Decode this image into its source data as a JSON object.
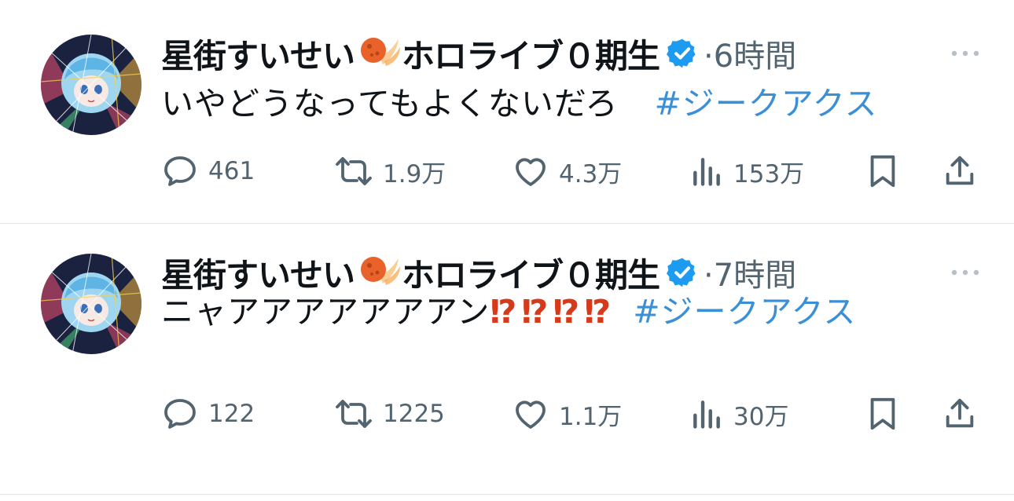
{
  "tweets": [
    {
      "author_name_part1": "星街すいせい",
      "author_name_part2": "ホロライブ０期生",
      "time": "·6時間",
      "text": "いやどうなってもよくないだろ",
      "hashtag": "#ジークアクス",
      "reply_count": "461",
      "retweet_count": "1.9万",
      "like_count": "4.3万",
      "view_count": "153万"
    },
    {
      "author_name_part1": "星街すいせい",
      "author_name_part2": "ホロライブ０期生",
      "time": "·7時間",
      "text": "ニャアアアアアアアン",
      "emphasis": "⁉⁉⁉⁉",
      "hashtag": "#ジークアクス",
      "reply_count": "122",
      "retweet_count": "1225",
      "like_count": "1.1万",
      "view_count": "30万"
    }
  ],
  "icons": {
    "reply": "reply-bubble-icon",
    "retweet": "retweet-icon",
    "like": "heart-icon",
    "views": "bar-chart-icon",
    "bookmark": "bookmark-icon",
    "share": "share-upload-icon",
    "verified": "verified-badge-icon",
    "more": "more-dots-icon"
  },
  "colors": {
    "hashtag": "#3a8fd6",
    "muted": "#536471",
    "verified": "#1d9bf0",
    "emphasis": "#d63a1a"
  }
}
